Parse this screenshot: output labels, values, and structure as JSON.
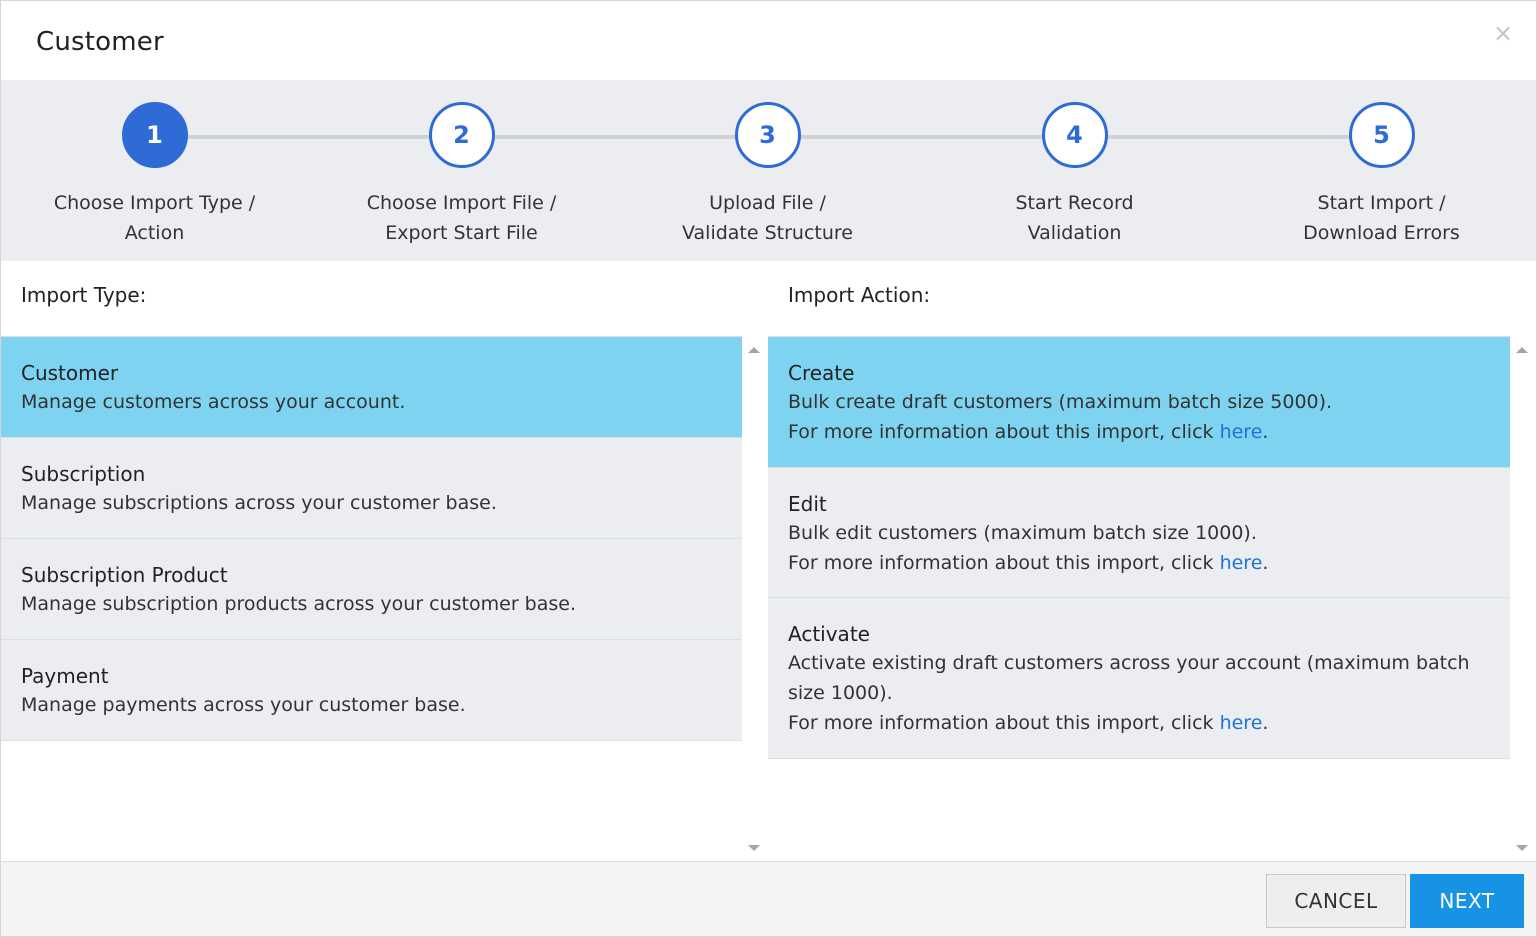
{
  "window": {
    "title": "Customer",
    "close_label": "×"
  },
  "steps": [
    {
      "number": "1",
      "label": "Choose Import Type /\nAction",
      "active": true
    },
    {
      "number": "2",
      "label": "Choose Import File /\nExport Start File",
      "active": false
    },
    {
      "number": "3",
      "label": "Upload File /\nValidate Structure",
      "active": false
    },
    {
      "number": "4",
      "label": "Start Record\nValidation",
      "active": false
    },
    {
      "number": "5",
      "label": "Start Import /\nDownload Errors",
      "active": false
    }
  ],
  "import_type": {
    "heading": "Import Type:",
    "items": [
      {
        "title": "Customer",
        "description": "Manage customers across your account.",
        "selected": true
      },
      {
        "title": "Subscription",
        "description": "Manage subscriptions across your customer base.",
        "selected": false
      },
      {
        "title": "Subscription Product",
        "description": "Manage subscription products across your customer base.",
        "selected": false
      },
      {
        "title": "Payment",
        "description": "Manage payments across your customer base.",
        "selected": false
      }
    ]
  },
  "import_action": {
    "heading": "Import Action:",
    "link_prefix": "For more information about this import, click ",
    "link_text": "here",
    "link_suffix": ".",
    "items": [
      {
        "title": "Create",
        "description": "Bulk create draft customers (maximum batch size 5000).",
        "selected": true
      },
      {
        "title": "Edit",
        "description": "Bulk edit customers (maximum batch size 1000).",
        "selected": false
      },
      {
        "title": "Activate",
        "description": "Activate existing draft customers across your account (maximum batch size 1000).",
        "selected": false
      }
    ]
  },
  "footer": {
    "cancel_label": "CANCEL",
    "next_label": "NEXT"
  },
  "colors": {
    "primary": "#2f6bd6",
    "selected_row": "#7ed3f0",
    "next_button": "#1793e6",
    "link": "#1e73d8"
  },
  "icons": {
    "close": "close-icon",
    "scroll_up": "arrow-up-icon",
    "scroll_down": "arrow-down-icon"
  }
}
